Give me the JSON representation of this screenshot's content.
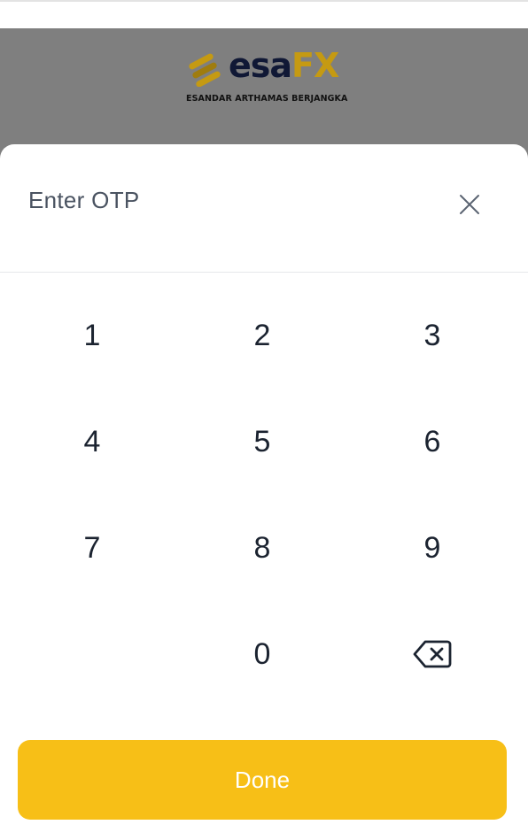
{
  "brand": {
    "name_part1": "esa",
    "name_part2": "FX",
    "tagline": "ESANDAR ARTHAMAS BERJANGKA",
    "primary_color": "#101835",
    "accent_color": "#c59a12"
  },
  "otp_sheet": {
    "title": "Enter OTP",
    "close_icon": "close-icon",
    "keypad": {
      "keys": [
        "1",
        "2",
        "3",
        "4",
        "5",
        "6",
        "7",
        "8",
        "9",
        "0"
      ],
      "backspace_icon": "backspace-icon"
    },
    "done_label": "Done",
    "done_color": "#f7bf17"
  }
}
